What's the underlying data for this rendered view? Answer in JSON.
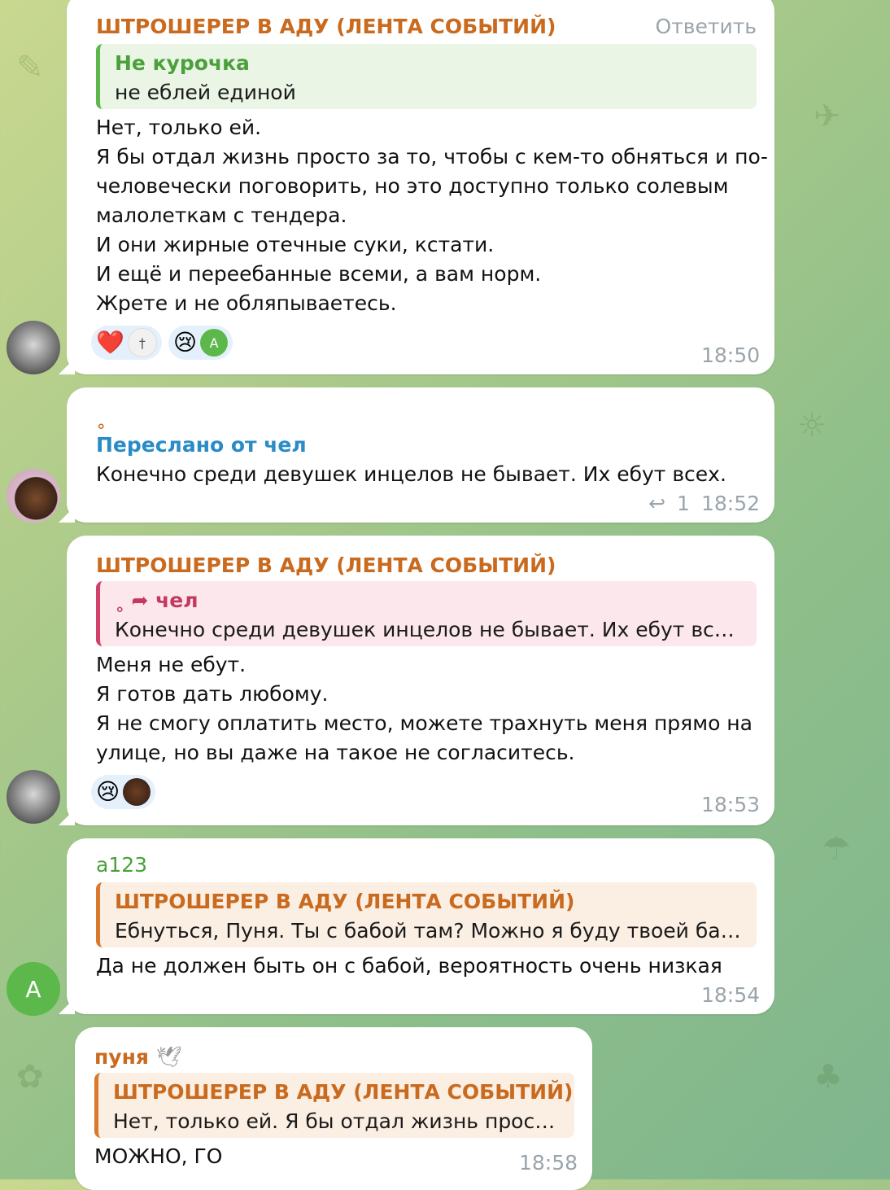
{
  "colors": {
    "accent_orange": "#c96a1e",
    "accent_green": "#4aa03a",
    "accent_blue": "#2a8bc7",
    "time_gray": "#9aa4ab"
  },
  "m1": {
    "sender": "ШТРОШЕРЕР В АДУ (ЛЕНТА СОБЫТИЙ)",
    "reply_label": "Ответить",
    "quote_title": "Не курочка",
    "quote_body": "не еблей единой",
    "lines": [
      "Нет, только ей.",
      "Я бы отдал жизнь просто за то, чтобы с кем-то обняться и по-",
      "человечески поговорить, но это доступно только солевым",
      "малолеткам с тендера.",
      "И они жирные отечные суки, кстати.",
      "И ещё и переебанные всеми, а вам норм.",
      "Жрете и не обляпываетесь."
    ],
    "reactions": [
      "❤️",
      "😢"
    ],
    "reaction_avatar_letter": "A",
    "time": "18:50"
  },
  "m2": {
    "dot": "˳",
    "forward_label": "Переслано от чел",
    "text": "Конечно среди девушек инцелов не бывает. Их ебут всех.",
    "reply_count": "1",
    "time": "18:52"
  },
  "m3": {
    "sender": "ШТРОШЕРЕР В АДУ (ЛЕНТА СОБЫТИЙ)",
    "quote_title": "чел",
    "quote_body": "Конечно среди девушек инцелов не бывает. Их ебут всех.",
    "lines": [
      "Меня не ебут.",
      "Я готов дать любому.",
      "Я не смогу оплатить место, можете трахнуть меня прямо на",
      "улице, но вы даже на такое не согласитесь."
    ],
    "reactions": [
      "😢"
    ],
    "time": "18:53"
  },
  "m4": {
    "sender": "a123",
    "quote_title": "ШТРОШЕРЕР В АДУ (ЛЕНТА СОБЫТИЙ)",
    "quote_body": "Ебнуться, Пуня. Ты с бабой там? Можно я буду твоей бабой ...",
    "text": "Да не должен быть он с бабой, вероятность очень низкая",
    "avatar_letter": "A",
    "time": "18:54"
  },
  "m5": {
    "sender": "пуня",
    "quote_title": "ШТРОШЕРЕР В АДУ (ЛЕНТА СОБЫТИЙ)",
    "quote_body": "Нет, только ей. Я бы отдал жизнь просто з...",
    "text": "МОЖНО, ГО",
    "time": "18:58"
  }
}
